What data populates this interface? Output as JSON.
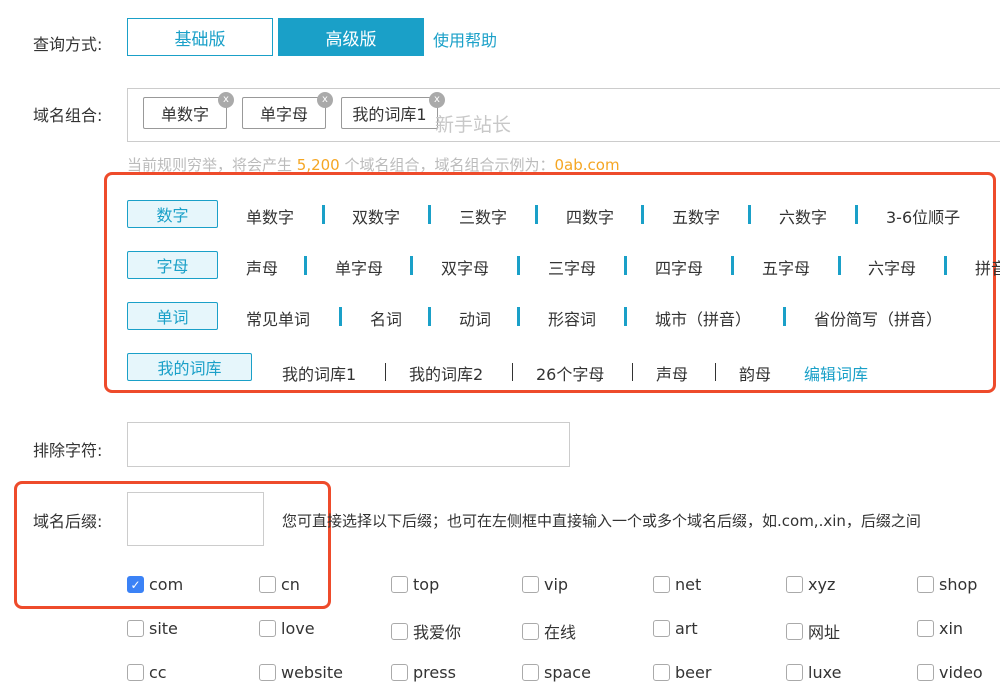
{
  "query_mode": {
    "label": "查询方式:",
    "basic": "基础版",
    "advanced": "高级版",
    "help": "使用帮助"
  },
  "combo": {
    "label": "域名组合:",
    "tags": [
      {
        "text": "单数字",
        "x": "x"
      },
      {
        "text": "单字母",
        "x": "x"
      },
      {
        "text": "我的词库1",
        "x": "x"
      }
    ],
    "watermark": "新手站长",
    "info_prefix": "当前规则穷举，将会产生 ",
    "info_count": "5,200",
    "info_mid": " 个域名组合，域名组合示例为：",
    "info_example": "0ab.com"
  },
  "categories": {
    "digits": {
      "button": "数字",
      "options": [
        "单数字",
        "双数字",
        "三数字",
        "四数字",
        "五数字",
        "六数字",
        "3-6位顺子"
      ]
    },
    "letters": {
      "button": "字母",
      "options": [
        "声母",
        "单字母",
        "双字母",
        "三字母",
        "四字母",
        "五字母",
        "六字母",
        "拼音"
      ]
    },
    "words": {
      "button": "单词",
      "options": [
        "常见单词",
        "名词",
        "动词",
        "形容词",
        "城市（拼音）",
        "省份简写（拼音）"
      ]
    },
    "library": {
      "button": "我的词库",
      "options": [
        "我的词库1",
        "我的词库2",
        "26个字母",
        "声母",
        "韵母"
      ],
      "edit": "编辑词库"
    }
  },
  "exclude": {
    "label": "排除字符:",
    "value": ""
  },
  "suffix": {
    "label": "域名后缀:",
    "value": "",
    "hint": "您可直接选择以下后缀；也可在左侧框中直接输入一个或多个域名后缀，如.com,.xin，后缀之间",
    "rows": [
      [
        {
          "t": "com",
          "c": true
        },
        {
          "t": "cn",
          "c": false
        },
        {
          "t": "top",
          "c": false
        },
        {
          "t": "vip",
          "c": false
        },
        {
          "t": "net",
          "c": false
        },
        {
          "t": "xyz",
          "c": false
        },
        {
          "t": "shop",
          "c": false
        }
      ],
      [
        {
          "t": "site",
          "c": false
        },
        {
          "t": "love",
          "c": false
        },
        {
          "t": "我爱你",
          "c": false
        },
        {
          "t": "在线",
          "c": false
        },
        {
          "t": "art",
          "c": false
        },
        {
          "t": "网址",
          "c": false
        },
        {
          "t": "xin",
          "c": false
        }
      ],
      [
        {
          "t": "cc",
          "c": false
        },
        {
          "t": "website",
          "c": false
        },
        {
          "t": "press",
          "c": false
        },
        {
          "t": "space",
          "c": false
        },
        {
          "t": "beer",
          "c": false
        },
        {
          "t": "luxe",
          "c": false
        },
        {
          "t": "video",
          "c": false
        }
      ]
    ]
  },
  "colors": {
    "accent": "#1aa0c8",
    "highlight": "#ee4b2b",
    "count": "#f5a623",
    "checkbox": "#3b82f6"
  }
}
